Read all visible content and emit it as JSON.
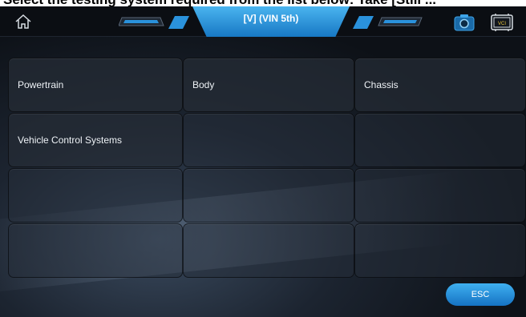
{
  "instruction_text": "Select the testing system required from the list below: Take [Still ...",
  "header": {
    "title": "[V] (VIN 5th)",
    "home_icon": "home-icon",
    "camera_icon": "camera-icon",
    "vci_icon": "vci-icon"
  },
  "menu": {
    "items": [
      {
        "label": "Powertrain"
      },
      {
        "label": "Body"
      },
      {
        "label": "Chassis"
      },
      {
        "label": "Vehicle Control Systems"
      },
      {
        "label": ""
      },
      {
        "label": ""
      },
      {
        "label": ""
      },
      {
        "label": ""
      },
      {
        "label": ""
      },
      {
        "label": ""
      },
      {
        "label": ""
      },
      {
        "label": ""
      }
    ]
  },
  "footer": {
    "esc_label": "ESC"
  },
  "colors": {
    "accent_blue": "#2a92dc",
    "background_dark": "#0d1117",
    "cell_bg": "#262c36"
  }
}
